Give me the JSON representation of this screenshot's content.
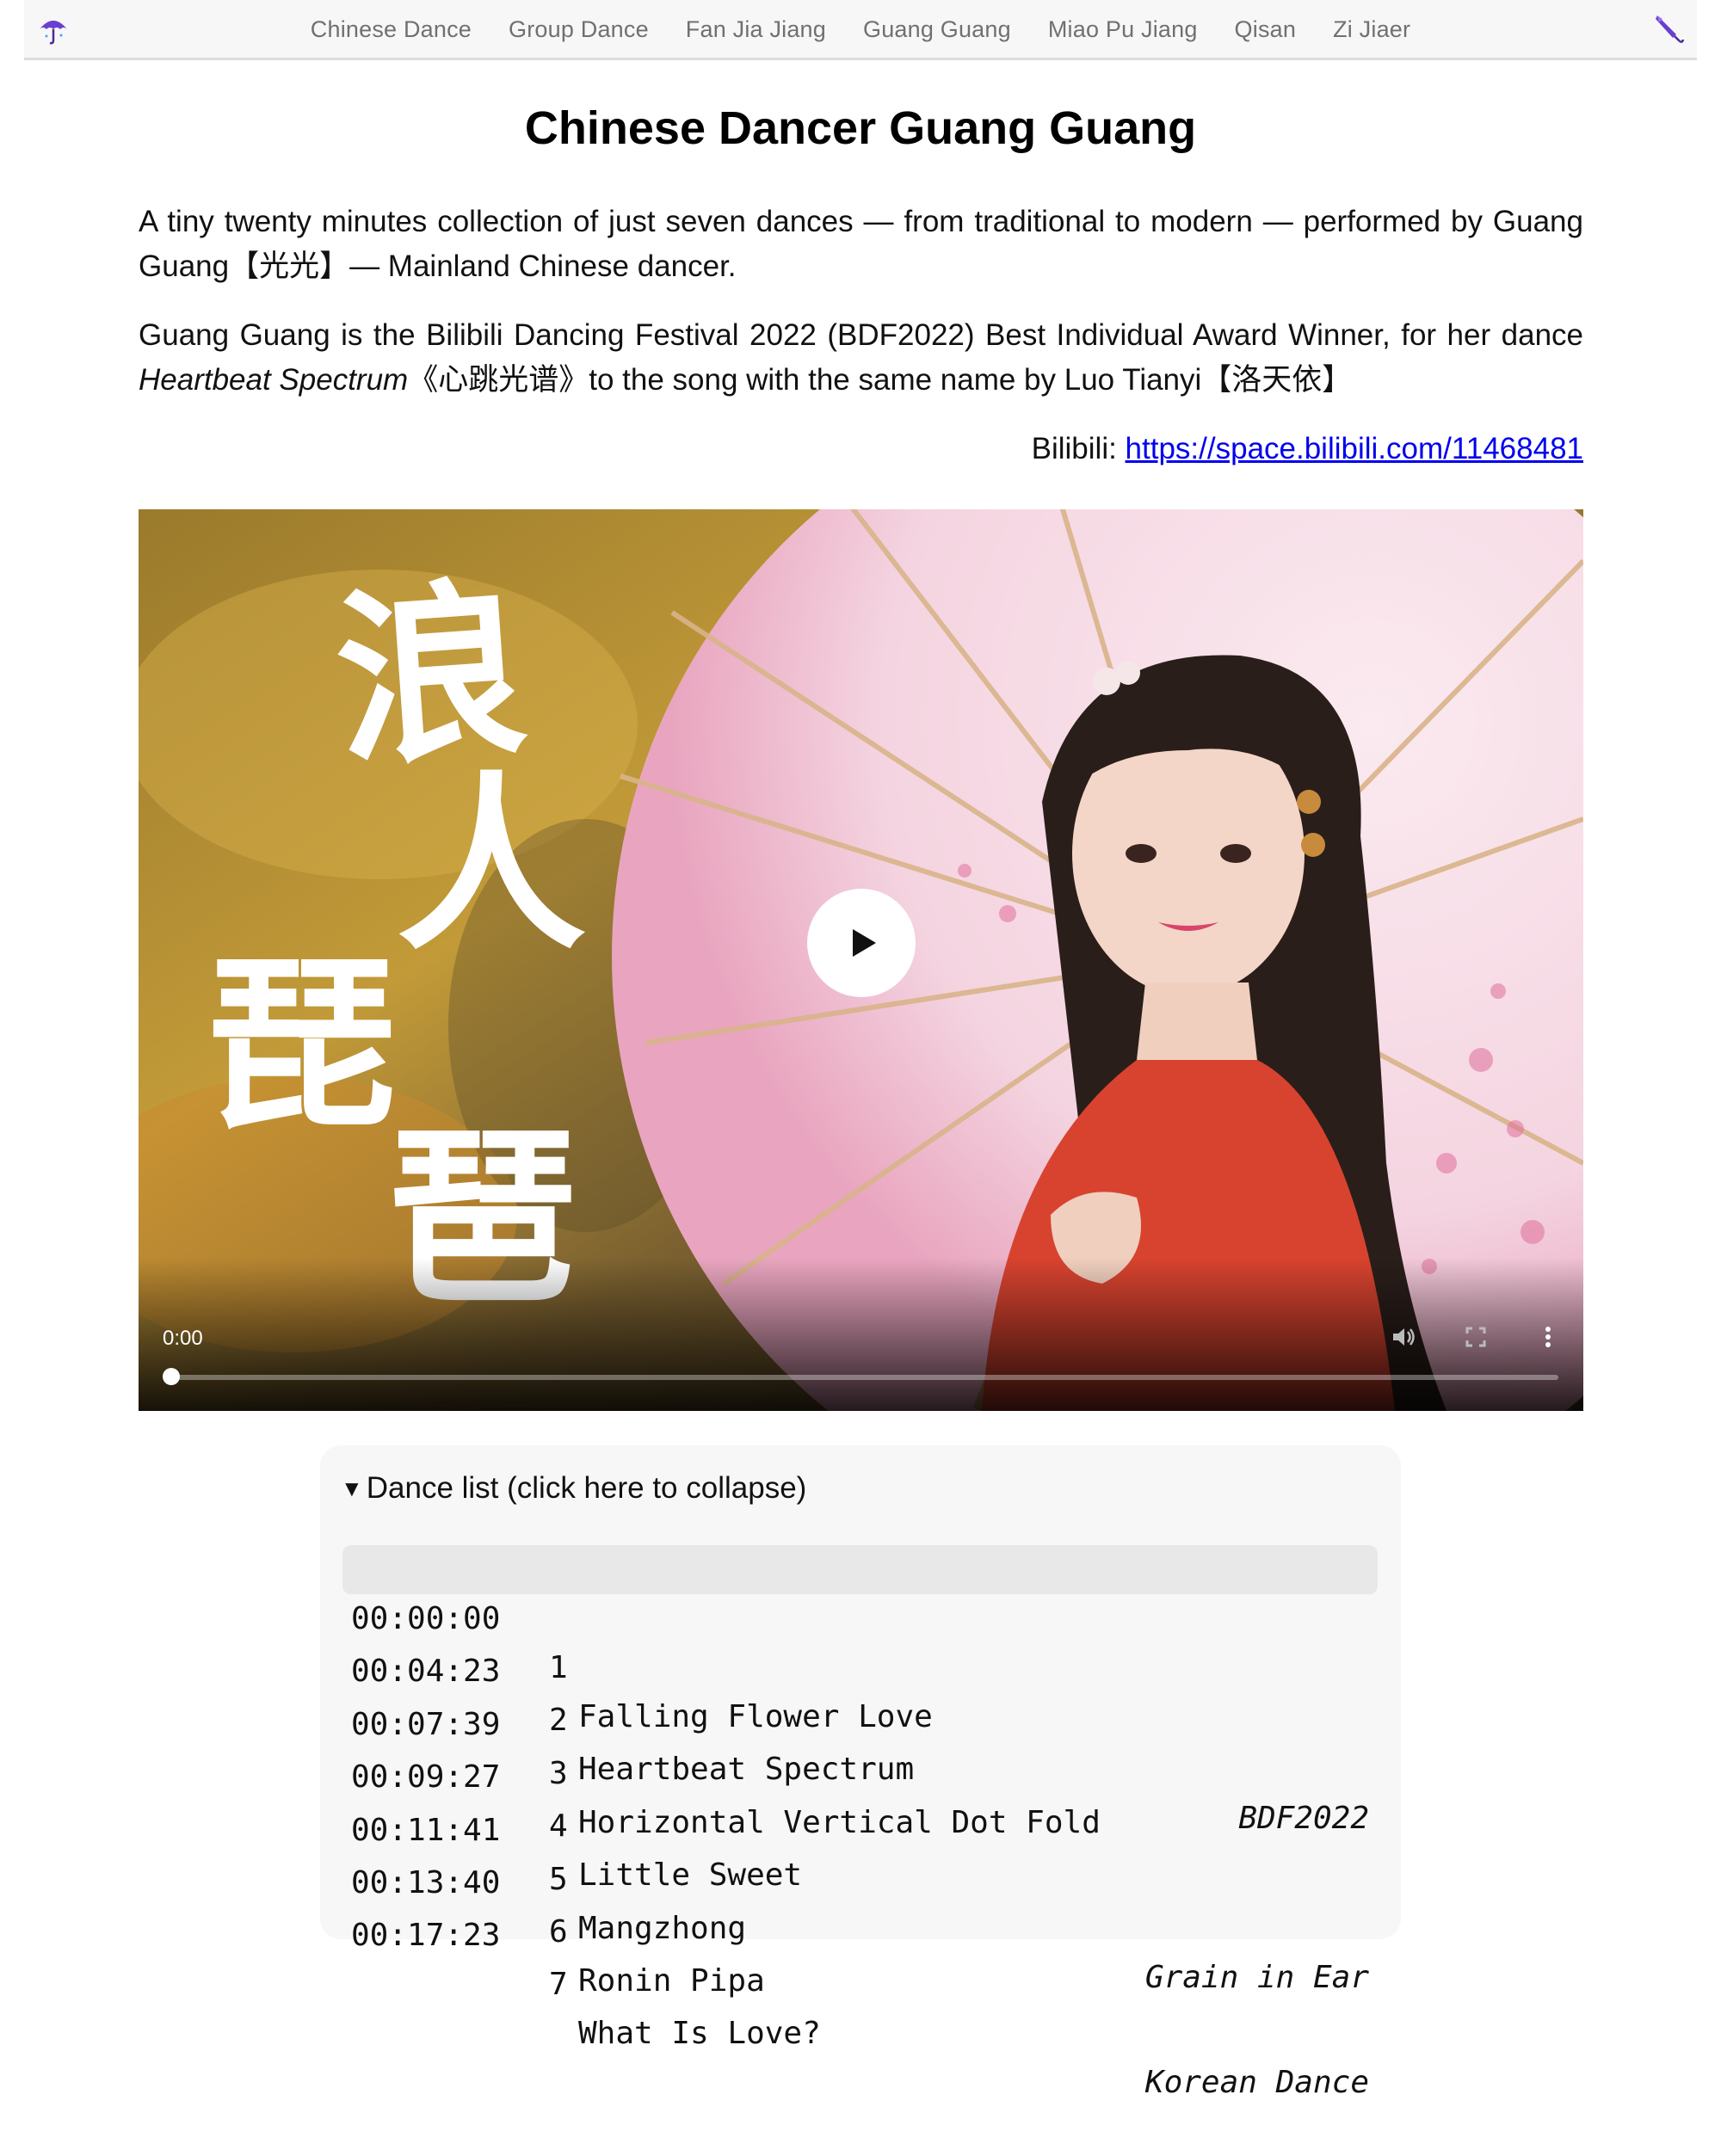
{
  "nav": {
    "items": [
      "Chinese Dance",
      "Group Dance",
      "Fan Jia Jiang",
      "Guang Guang",
      "Miao Pu Jiang",
      "Qisan",
      "Zi Jiaer"
    ],
    "left_icon": "umbrella-icon",
    "right_icon": "closed-umbrella-icon"
  },
  "page": {
    "title": "Chinese Dancer Guang Guang",
    "intro": {
      "text": "A tiny twenty minutes collection of just seven dances — from traditional to modern — performed by Guang Guang【光光】— Mainland Chinese dancer."
    },
    "award": {
      "before": "Guang Guang is the Bilibili Dancing Festival 2022 (BDF2022) Best Individual Award Winner, for her dance ",
      "italic": "Heartbeat Spectrum",
      "after": "《心跳光谱》to the song with the same name by Luo Tianyi【洛天依】"
    },
    "bilibili": {
      "label": "Bilibili: ",
      "link": "https://space.bilibili.com/11468481"
    }
  },
  "video": {
    "poster_text": "浪人琵琶",
    "current_time": "0:00",
    "progress": 0,
    "icons": [
      "play-icon",
      "volume-icon",
      "fullscreen-icon",
      "more-vert-icon"
    ]
  },
  "dance_list": {
    "summary": "Dance list (click here to collapse)",
    "rows": [
      {
        "time": "00:00:00",
        "num": "1",
        "name": "Falling Flower Love",
        "note": ""
      },
      {
        "time": "00:04:23",
        "num": "2",
        "name": "Heartbeat Spectrum",
        "note": "BDF2022"
      },
      {
        "time": "00:07:39",
        "num": "3",
        "name": "Horizontal Vertical Dot Fold",
        "note": ""
      },
      {
        "time": "00:09:27",
        "num": "4",
        "name": "Little Sweet",
        "note": ""
      },
      {
        "time": "00:11:41",
        "num": "5",
        "name": "Mangzhong",
        "note": "Grain in Ear"
      },
      {
        "time": "00:13:40",
        "num": "6",
        "name": "Ronin Pipa",
        "note": ""
      },
      {
        "time": "00:17:23",
        "num": "7",
        "name": "What Is Love?",
        "note": "Korean Dance"
      }
    ]
  },
  "colors": {
    "link": "#0000ee",
    "nav_text": "#707070",
    "nav_bg": "#f7f7f7",
    "list_bg": "#f7f7f7",
    "active_row": "#e8e8e8"
  }
}
